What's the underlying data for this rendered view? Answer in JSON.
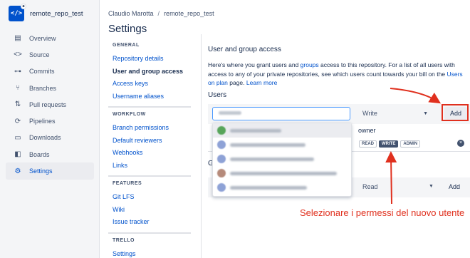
{
  "repo": {
    "name": "remote_repo_test",
    "logo_text": "</>"
  },
  "sidebar": {
    "items": [
      {
        "label": "Overview",
        "icon": "overview-icon",
        "glyph": "▤"
      },
      {
        "label": "Source",
        "icon": "source-icon",
        "glyph": "<>"
      },
      {
        "label": "Commits",
        "icon": "commits-icon",
        "glyph": "⊶"
      },
      {
        "label": "Branches",
        "icon": "branches-icon",
        "glyph": "⑂"
      },
      {
        "label": "Pull requests",
        "icon": "pull-requests-icon",
        "glyph": "⇅"
      },
      {
        "label": "Pipelines",
        "icon": "pipelines-icon",
        "glyph": "⟳"
      },
      {
        "label": "Downloads",
        "icon": "downloads-icon",
        "glyph": "▭"
      },
      {
        "label": "Boards",
        "icon": "boards-icon",
        "glyph": "◧"
      },
      {
        "label": "Settings",
        "icon": "settings-icon",
        "glyph": "⚙"
      }
    ],
    "active": "Settings"
  },
  "breadcrumb": {
    "user": "Claudio Marotta",
    "separator": "/",
    "repo": "remote_repo_test"
  },
  "page_title": "Settings",
  "subnav": {
    "general": {
      "heading": "GENERAL",
      "links": [
        "Repository details",
        "User and group access",
        "Access keys",
        "Username aliases"
      ]
    },
    "workflow": {
      "heading": "WORKFLOW",
      "links": [
        "Branch permissions",
        "Default reviewers",
        "Webhooks",
        "Links"
      ]
    },
    "features": {
      "heading": "FEATURES",
      "links": [
        "Git LFS",
        "Wiki",
        "Issue tracker"
      ]
    },
    "trello": {
      "heading": "TRELLO",
      "links": [
        "Settings"
      ]
    },
    "current": "User and group access"
  },
  "access": {
    "title": "User and group access",
    "desc_1": "Here's where you grant users and ",
    "desc_link_groups": "groups",
    "desc_2": " access to this repository. For a list of all users with access to any of your private repositories, see which users count towards your bill on the ",
    "desc_link_users": "Users on plan",
    "desc_3": " page. ",
    "desc_link_learn": "Learn more",
    "users_title": "Users",
    "permission_select": "Write",
    "add_label": "Add",
    "owner_label": "owner",
    "permissions": [
      "READ",
      "WRITE",
      "ADMIN"
    ],
    "selected_permission": "WRITE",
    "groups_title": "G",
    "group_permission": "Read",
    "group_add_label": "Add"
  },
  "colors": {
    "accent": "#0052cc",
    "annotation": "#e0301e",
    "sidebar_bg": "#f4f5f7"
  },
  "annotation": "Selezionare i permessi del nuovo utente"
}
